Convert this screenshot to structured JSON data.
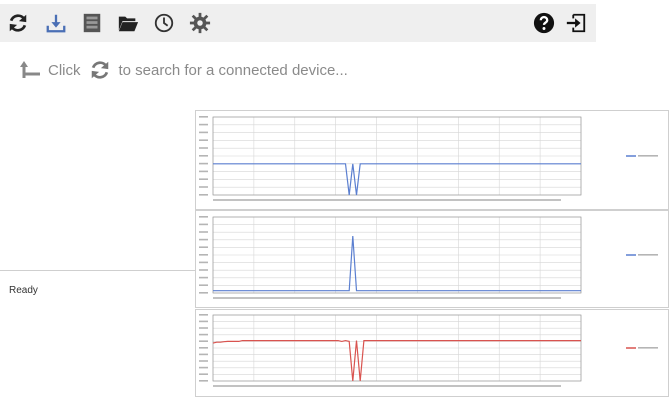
{
  "toolbar": {
    "icons": [
      "refresh-icon",
      "download-icon",
      "database-icon",
      "folder-open-icon",
      "clock-icon",
      "gear-icon",
      "help-icon",
      "exit-icon"
    ]
  },
  "hint": {
    "prefix": "Click",
    "suffix": "to search for a connected device..."
  },
  "status": {
    "text": "Ready"
  },
  "colors": {
    "blue": "#5b7fd0",
    "red": "#d9534f",
    "grid": "#d6d6d6",
    "toolbar_bg": "#efefef"
  },
  "chart_data": [
    {
      "type": "line",
      "ylim": [
        0,
        5
      ],
      "series": [
        {
          "color": "#5b7fd0",
          "values": [
            2.0,
            2.0,
            2.0,
            2.0,
            2.0,
            2.0,
            2.0,
            2.0,
            2.0,
            2.0,
            2.0,
            2.0,
            2.0,
            2.0,
            2.0,
            2.0,
            2.0,
            2.0,
            2.0,
            2.0,
            2.0,
            2.0,
            2.0,
            2.0,
            2.0,
            2.0,
            2.0,
            2.0,
            2.0,
            2.0,
            2.0,
            2.0,
            2.0,
            2.0,
            2.0,
            2.0,
            2.0,
            0.0,
            2.0,
            0.0,
            2.0,
            2.0,
            2.0,
            2.0,
            2.0,
            2.0,
            2.0,
            2.0,
            2.0,
            2.0,
            2.0,
            2.0,
            2.0,
            2.0,
            2.0,
            2.0,
            2.0,
            2.0,
            2.0,
            2.0,
            2.0,
            2.0,
            2.0,
            2.0,
            2.0,
            2.0,
            2.0,
            2.0,
            2.0,
            2.0,
            2.0,
            2.0,
            2.0,
            2.0,
            2.0,
            2.0,
            2.0,
            2.0,
            2.0,
            2.0,
            2.0,
            2.0,
            2.0,
            2.0,
            2.0,
            2.0,
            2.0,
            2.0,
            2.0,
            2.0,
            2.0,
            2.0,
            2.0,
            2.0,
            2.0,
            2.0,
            2.0,
            2.0,
            2.0,
            2.0,
            2.0
          ]
        }
      ]
    },
    {
      "type": "line",
      "ylim": [
        0,
        1000
      ],
      "series": [
        {
          "color": "#5b7fd0",
          "values": [
            30,
            30,
            30,
            30,
            30,
            30,
            30,
            30,
            30,
            30,
            30,
            30,
            30,
            30,
            30,
            30,
            30,
            30,
            30,
            30,
            30,
            30,
            30,
            30,
            30,
            30,
            30,
            30,
            30,
            30,
            30,
            30,
            30,
            30,
            30,
            30,
            30,
            30,
            750,
            30,
            30,
            30,
            30,
            30,
            30,
            30,
            30,
            30,
            30,
            30,
            30,
            30,
            30,
            30,
            30,
            30,
            30,
            30,
            30,
            30,
            30,
            30,
            30,
            30,
            30,
            30,
            30,
            30,
            30,
            30,
            30,
            30,
            30,
            30,
            30,
            30,
            30,
            30,
            30,
            30,
            30,
            30,
            30,
            30,
            30,
            30,
            30,
            30,
            30,
            30,
            30,
            30,
            30,
            30,
            30,
            30,
            30,
            30,
            30,
            30,
            30
          ]
        }
      ]
    },
    {
      "type": "line",
      "ylim": [
        0,
        400
      ],
      "series": [
        {
          "color": "#d9534f",
          "values": [
            230,
            235,
            235,
            238,
            240,
            240,
            240,
            240,
            245,
            245,
            245,
            245,
            245,
            245,
            245,
            245,
            245,
            245,
            245,
            245,
            245,
            245,
            245,
            245,
            245,
            245,
            245,
            245,
            245,
            245,
            245,
            245,
            245,
            245,
            245,
            240,
            245,
            240,
            0,
            245,
            0,
            245,
            245,
            245,
            245,
            245,
            245,
            245,
            245,
            245,
            245,
            245,
            245,
            245,
            245,
            245,
            245,
            245,
            245,
            245,
            245,
            245,
            245,
            245,
            245,
            245,
            245,
            245,
            245,
            245,
            245,
            245,
            245,
            245,
            245,
            245,
            245,
            245,
            245,
            245,
            245,
            245,
            245,
            245,
            245,
            245,
            245,
            245,
            245,
            245,
            245,
            245,
            245,
            245,
            245,
            245,
            245,
            245,
            245,
            245,
            245
          ]
        }
      ]
    }
  ]
}
